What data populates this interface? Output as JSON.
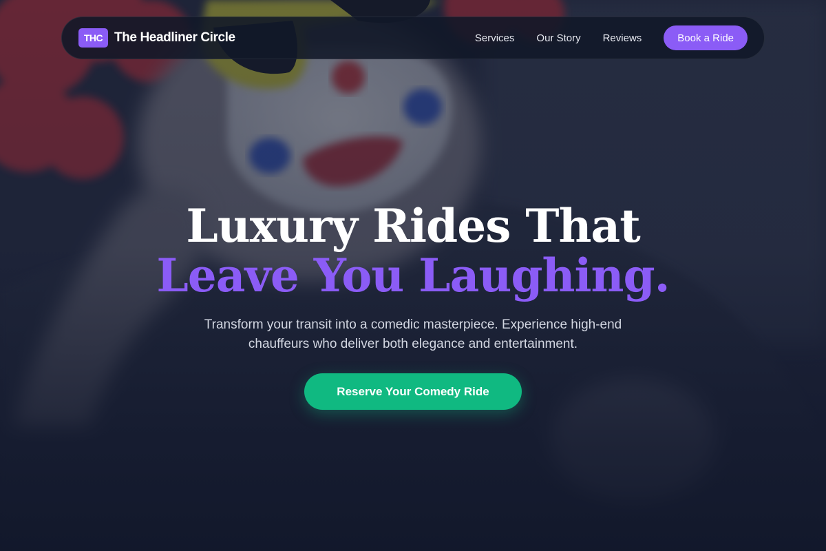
{
  "brand": {
    "badge": "THC",
    "name": "The Headliner Circle"
  },
  "nav": {
    "links": [
      "Services",
      "Our Story",
      "Reviews"
    ],
    "cta_label": "Book a Ride"
  },
  "hero": {
    "headline_line1": "Luxury Rides That",
    "headline_line2": "Leave You Laughing.",
    "subheading": "Transform your transit into a comedic masterpiece. Experience high-end chauffeurs who deliver both elegance and entertainment.",
    "cta_label": "Reserve Your Comedy Ride",
    "background_icon": "clown-photo"
  },
  "colors": {
    "accent_purple": "#8b5cf6",
    "cta_green": "#10b981",
    "nav_background": "#111828",
    "page_background": "#1b2236"
  }
}
